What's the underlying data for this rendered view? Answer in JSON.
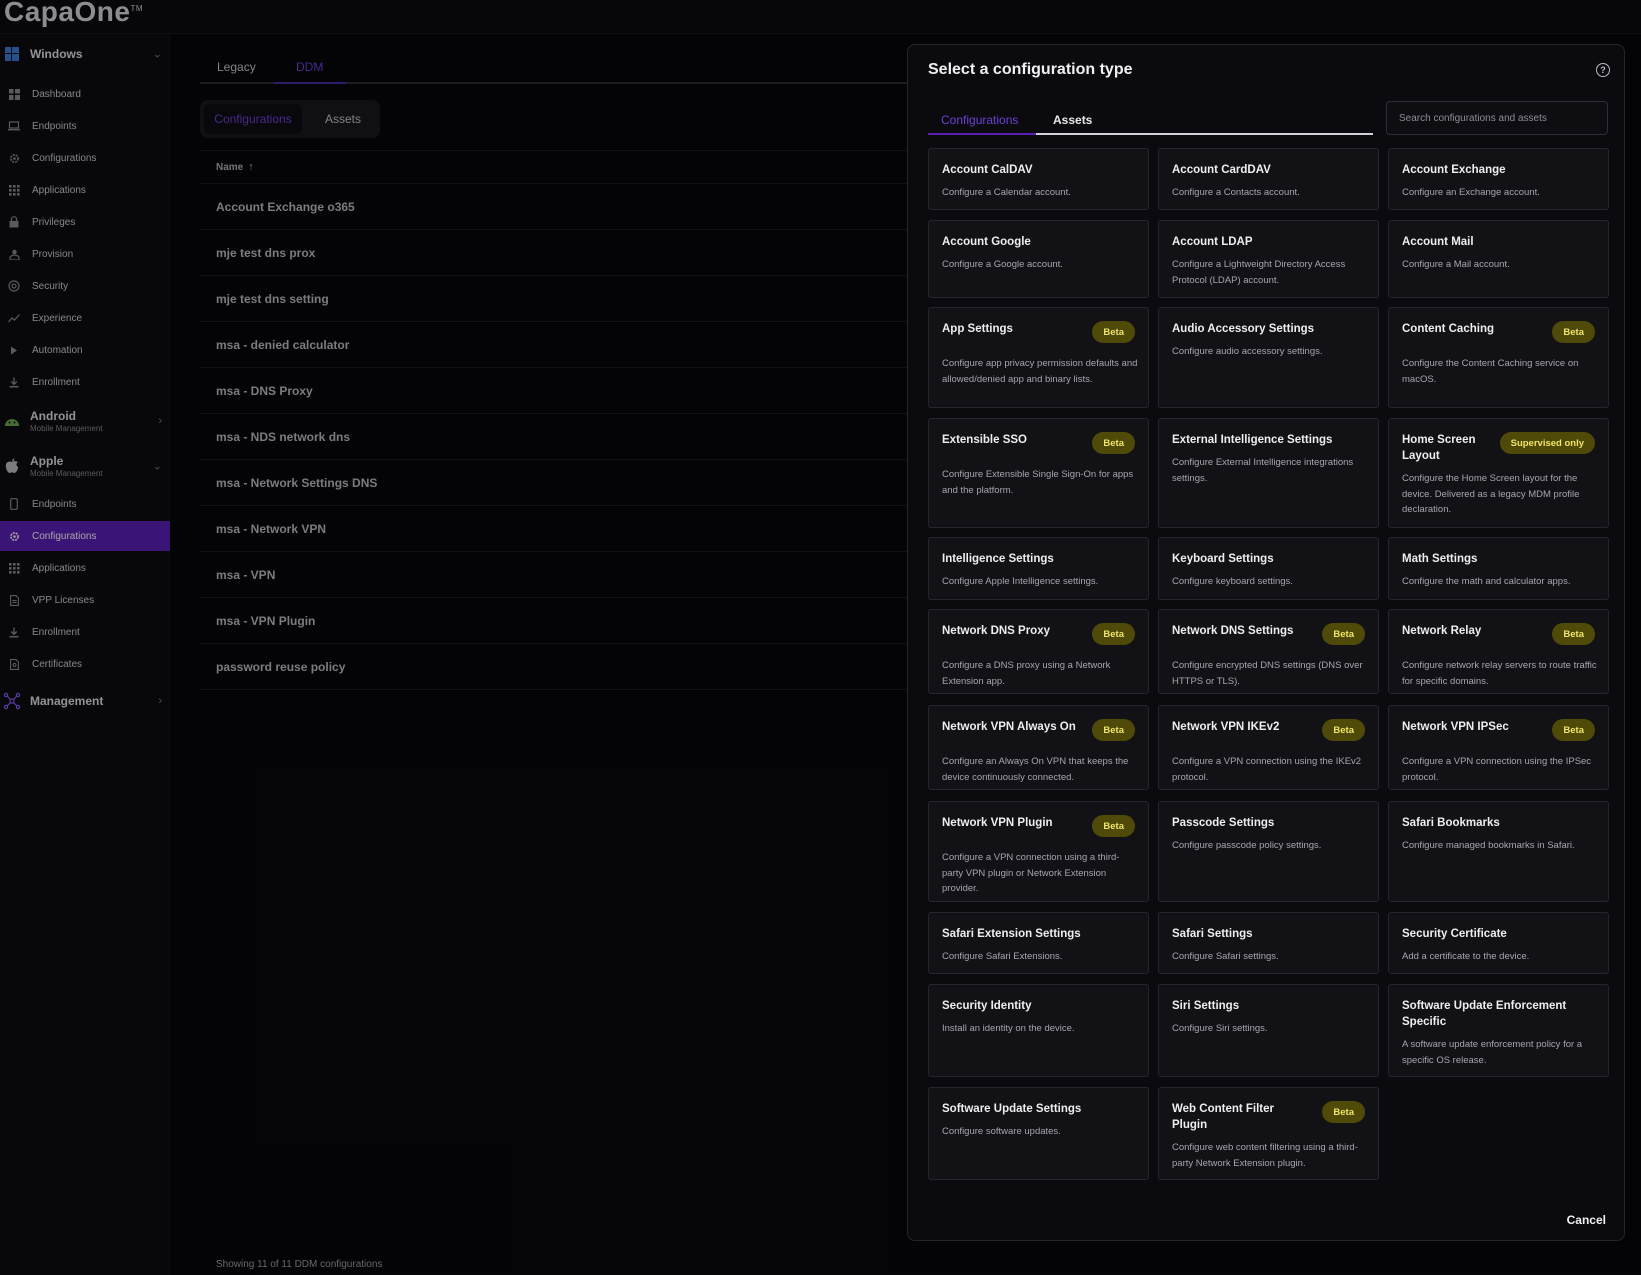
{
  "app": {
    "logo": "CapaOne",
    "trademark": "TM"
  },
  "sidebar": {
    "groups": [
      {
        "label": "Windows",
        "sub": "",
        "icon": "windows-icon",
        "expanded": true
      },
      {
        "label": "Android",
        "sub": "Mobile Management",
        "icon": "android-icon",
        "expanded": false
      },
      {
        "label": "Apple",
        "sub": "Mobile Management",
        "icon": "apple-icon",
        "expanded": true
      },
      {
        "label": "Management",
        "sub": "",
        "icon": "management-icon",
        "expanded": false
      }
    ],
    "windows_items": [
      {
        "label": "Dashboard",
        "icon": "dashboard-icon"
      },
      {
        "label": "Endpoints",
        "icon": "laptop-icon"
      },
      {
        "label": "Configurations",
        "icon": "gear-icon"
      },
      {
        "label": "Applications",
        "icon": "apps-grid-icon"
      },
      {
        "label": "Privileges",
        "icon": "lock-icon"
      },
      {
        "label": "Provision",
        "icon": "provision-icon"
      },
      {
        "label": "Security",
        "icon": "shield-icon"
      },
      {
        "label": "Experience",
        "icon": "trend-icon"
      },
      {
        "label": "Automation",
        "icon": "play-icon"
      },
      {
        "label": "Enrollment",
        "icon": "download-icon"
      }
    ],
    "apple_items": [
      {
        "label": "Endpoints",
        "icon": "phone-icon",
        "active": false
      },
      {
        "label": "Configurations",
        "icon": "gear-icon",
        "active": true
      },
      {
        "label": "Applications",
        "icon": "apps-grid-icon",
        "active": false
      },
      {
        "label": "VPP Licenses",
        "icon": "document-icon",
        "active": false
      },
      {
        "label": "Enrollment",
        "icon": "download-icon",
        "active": false
      },
      {
        "label": "Certificates",
        "icon": "certificate-icon",
        "active": false
      }
    ]
  },
  "main": {
    "tabs": [
      "Legacy",
      "DDM"
    ],
    "active_tab": "DDM",
    "segments": [
      "Configurations",
      "Assets"
    ],
    "table": {
      "column": "Name",
      "rows": [
        "Account Exchange o365",
        "mje test dns prox",
        "mje test dns setting",
        "msa - denied calculator",
        "msa - DNS Proxy",
        "msa - NDS network dns",
        "msa - Network Settings DNS",
        "msa - Network VPN",
        "msa - VPN",
        "msa - VPN Plugin",
        "password reuse policy"
      ]
    },
    "footer": "Showing 11 of 11 DDM configurations"
  },
  "modal": {
    "title": "Select a configuration type",
    "tabs": [
      "Configurations",
      "Assets"
    ],
    "search_placeholder": "Search configurations and assets",
    "cancel_label": "Cancel",
    "badge_color": "#4f4a08",
    "cards": [
      {
        "title": "Account CalDAV",
        "desc": "Configure a Calendar account.",
        "badge": ""
      },
      {
        "title": "Account CardDAV",
        "desc": "Configure a Contacts account.",
        "badge": ""
      },
      {
        "title": "Account Exchange",
        "desc": "Configure an Exchange account.",
        "badge": ""
      },
      {
        "title": "Account Google",
        "desc": "Configure a Google account.",
        "badge": ""
      },
      {
        "title": "Account LDAP",
        "desc": "Configure a Lightweight Directory Access Protocol (LDAP) account.",
        "badge": ""
      },
      {
        "title": "Account Mail",
        "desc": "Configure a Mail account.",
        "badge": ""
      },
      {
        "title": "App Settings",
        "desc": "Configure app privacy permission defaults and allowed/denied app and binary lists.",
        "badge": "Beta"
      },
      {
        "title": "Audio Accessory Settings",
        "desc": "Configure audio accessory settings.",
        "badge": ""
      },
      {
        "title": "Content Caching",
        "desc": "Configure the Content Caching service on macOS.",
        "badge": "Beta"
      },
      {
        "title": "Extensible SSO",
        "desc": "Configure Extensible Single Sign-On for apps and the platform.",
        "badge": "Beta"
      },
      {
        "title": "External Intelligence Settings",
        "desc": "Configure External Intelligence integrations settings.",
        "badge": ""
      },
      {
        "title": "Home Screen Layout",
        "desc": "Configure the Home Screen layout for the device. Delivered as a legacy MDM profile declaration.",
        "badge": "Supervised only"
      },
      {
        "title": "Intelligence Settings",
        "desc": "Configure Apple Intelligence settings.",
        "badge": ""
      },
      {
        "title": "Keyboard Settings",
        "desc": "Configure keyboard settings.",
        "badge": ""
      },
      {
        "title": "Math Settings",
        "desc": "Configure the math and calculator apps.",
        "badge": ""
      },
      {
        "title": "Network DNS Proxy",
        "desc": "Configure a DNS proxy using a Network Extension app.",
        "badge": "Beta"
      },
      {
        "title": "Network DNS Settings",
        "desc": "Configure encrypted DNS settings (DNS over HTTPS or TLS).",
        "badge": "Beta"
      },
      {
        "title": "Network Relay",
        "desc": "Configure network relay servers to route traffic for specific domains.",
        "badge": "Beta"
      },
      {
        "title": "Network VPN Always On",
        "desc": "Configure an Always On VPN that keeps the device continuously connected.",
        "badge": "Beta"
      },
      {
        "title": "Network VPN IKEv2",
        "desc": "Configure a VPN connection using the IKEv2 protocol.",
        "badge": "Beta"
      },
      {
        "title": "Network VPN IPSec",
        "desc": "Configure a VPN connection using the IPSec protocol.",
        "badge": "Beta"
      },
      {
        "title": "Network VPN Plugin",
        "desc": "Configure a VPN connection using a third-party VPN plugin or Network Extension provider.",
        "badge": "Beta"
      },
      {
        "title": "Passcode Settings",
        "desc": "Configure passcode policy settings.",
        "badge": ""
      },
      {
        "title": "Safari Bookmarks",
        "desc": "Configure managed bookmarks in Safari.",
        "badge": ""
      },
      {
        "title": "Safari Extension Settings",
        "desc": "Configure Safari Extensions.",
        "badge": ""
      },
      {
        "title": "Safari Settings",
        "desc": "Configure Safari settings.",
        "badge": ""
      },
      {
        "title": "Security Certificate",
        "desc": "Add a certificate to the device.",
        "badge": ""
      },
      {
        "title": "Security Identity",
        "desc": "Install an identity on the device.",
        "badge": ""
      },
      {
        "title": "Siri Settings",
        "desc": "Configure Siri settings.",
        "badge": ""
      },
      {
        "title": "Software Update Enforcement Specific",
        "desc": "A software update enforcement policy for a specific OS release.",
        "badge": ""
      },
      {
        "title": "Software Update Settings",
        "desc": "Configure software updates.",
        "badge": ""
      },
      {
        "title": "Web Content Filter Plugin",
        "desc": "Configure web content filtering using a third-party Network Extension plugin.",
        "badge": "Beta"
      }
    ]
  }
}
